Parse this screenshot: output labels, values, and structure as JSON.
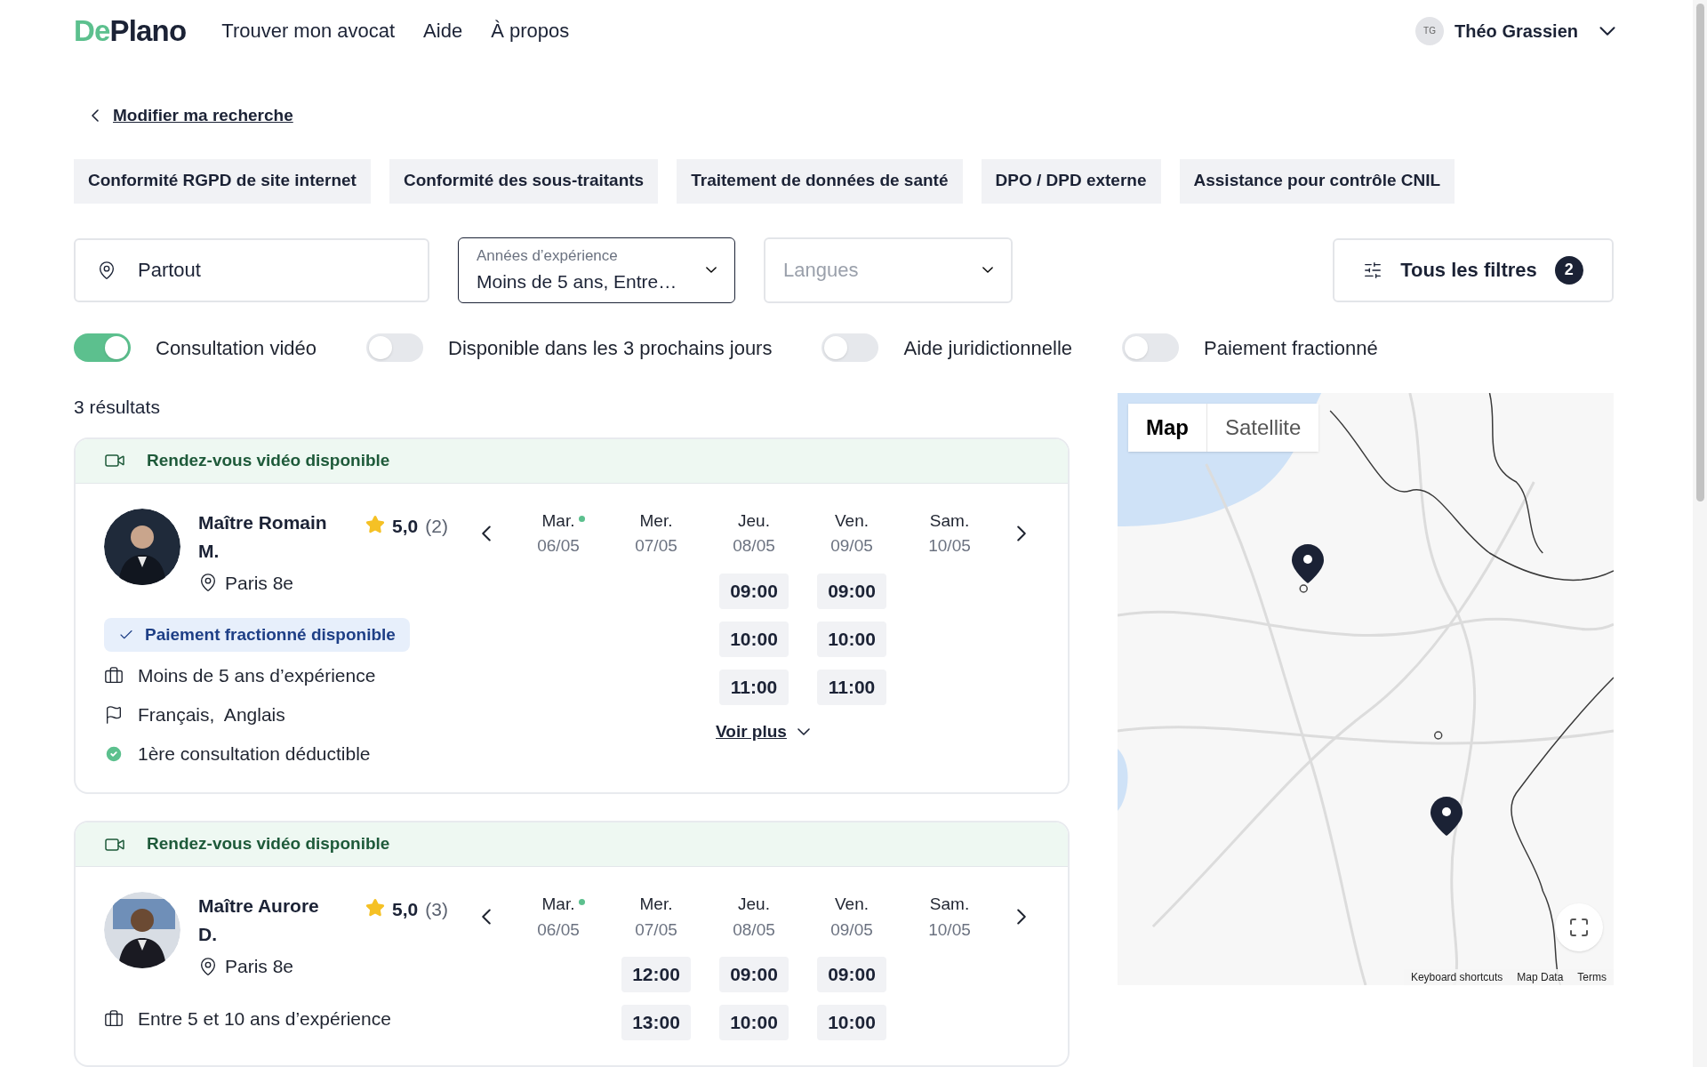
{
  "header": {
    "logo": {
      "part1": "De",
      "part2": "Plano"
    },
    "nav": [
      "Trouver mon avocat",
      "Aide",
      "À propos"
    ],
    "user": {
      "initials": "TG",
      "name": "Théo Grassien"
    }
  },
  "back_link": "Modifier ma recherche",
  "tags": [
    "Conformité RGPD de site internet",
    "Conformité des sous-traitants",
    "Traitement de données de santé",
    "DPO / DPD externe",
    "Assistance pour contrôle CNIL"
  ],
  "filters": {
    "location": {
      "value": "Partout"
    },
    "experience": {
      "label": "Années d’expérience",
      "value": "Moins de 5 ans, Entre…"
    },
    "languages": {
      "placeholder": "Langues"
    },
    "all_filters": {
      "label": "Tous les filtres",
      "count": "2"
    }
  },
  "toggles": [
    {
      "label": "Consultation vidéo",
      "on": true
    },
    {
      "label": "Disponible dans les 3 prochains jours",
      "on": false
    },
    {
      "label": "Aide juridictionnelle",
      "on": false
    },
    {
      "label": "Paiement fractionné",
      "on": false
    }
  ],
  "results_count": "3 résultats",
  "lawyers": [
    {
      "banner": "Rendez-vous vidéo disponible",
      "name": "Maître Romain M.",
      "rating": "5,0",
      "reviews": "(2)",
      "location": "Paris 8e",
      "badge": "Paiement fractionné disponible",
      "details": [
        {
          "kind": "experience",
          "text": "Moins de 5 ans d’expérience"
        },
        {
          "kind": "languages",
          "text": "Français,  Anglais"
        },
        {
          "kind": "deductible",
          "text": "1ère consultation déductible"
        }
      ],
      "days": [
        {
          "day": "Mar.",
          "date": "06/05",
          "today": true
        },
        {
          "day": "Mer.",
          "date": "07/05",
          "today": false
        },
        {
          "day": "Jeu.",
          "date": "08/05",
          "today": false,
          "slots": [
            "09:00",
            "10:00",
            "11:00"
          ]
        },
        {
          "day": "Ven.",
          "date": "09/05",
          "today": false,
          "slots": [
            "09:00",
            "10:00",
            "11:00"
          ]
        },
        {
          "day": "Sam.",
          "date": "10/05",
          "today": false
        }
      ],
      "more": "Voir plus"
    },
    {
      "banner": "Rendez-vous vidéo disponible",
      "name": "Maître Aurore D.",
      "rating": "5,0",
      "reviews": "(3)",
      "location": "Paris 8e",
      "details": [
        {
          "kind": "experience",
          "text": "Entre 5 et 10 ans d’expérience"
        }
      ],
      "days": [
        {
          "day": "Mar.",
          "date": "06/05",
          "today": true
        },
        {
          "day": "Mer.",
          "date": "07/05",
          "today": false,
          "slots": [
            "12:00",
            "13:00"
          ]
        },
        {
          "day": "Jeu.",
          "date": "08/05",
          "today": false,
          "slots": [
            "09:00",
            "10:00"
          ]
        },
        {
          "day": "Ven.",
          "date": "09/05",
          "today": false,
          "slots": [
            "09:00",
            "10:00"
          ]
        },
        {
          "day": "Sam.",
          "date": "10/05",
          "today": false
        }
      ]
    }
  ],
  "map": {
    "tabs": [
      {
        "label": "Map",
        "selected": true
      },
      {
        "label": "Satellite",
        "selected": false
      }
    ],
    "footer": [
      "Keyboard shortcuts",
      "Map Data",
      "Terms"
    ]
  }
}
